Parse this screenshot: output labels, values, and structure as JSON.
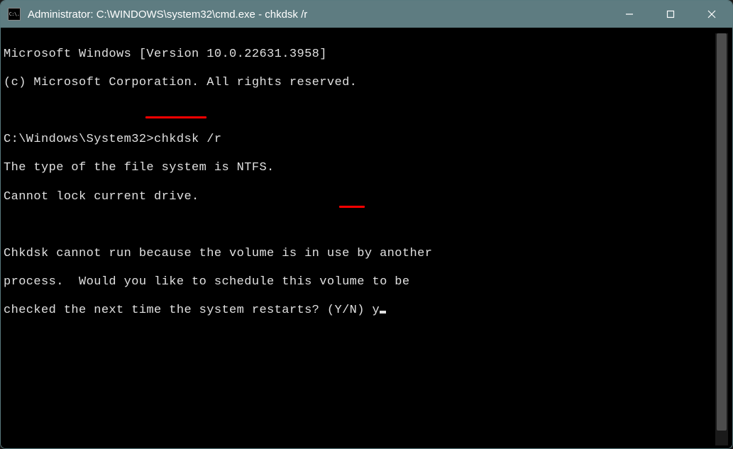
{
  "window": {
    "title": "Administrator: C:\\WINDOWS\\system32\\cmd.exe - chkdsk  /r",
    "app_icon_text": "C:\\."
  },
  "terminal": {
    "line1": "Microsoft Windows [Version 10.0.22631.3958]",
    "line2": "(c) Microsoft Corporation. All rights reserved.",
    "blank1": "",
    "prompt_path": "C:\\Windows\\System32>",
    "command": "chkdsk /r",
    "line4": "The type of the file system is NTFS.",
    "line5": "Cannot lock current drive.",
    "blank2": "",
    "line6": "Chkdsk cannot run because the volume is in use by another",
    "line7": "process.  Would you like to schedule this volume to be",
    "line8_prefix": "checked the next time the system restarts? (Y/N) ",
    "user_input": "y"
  }
}
